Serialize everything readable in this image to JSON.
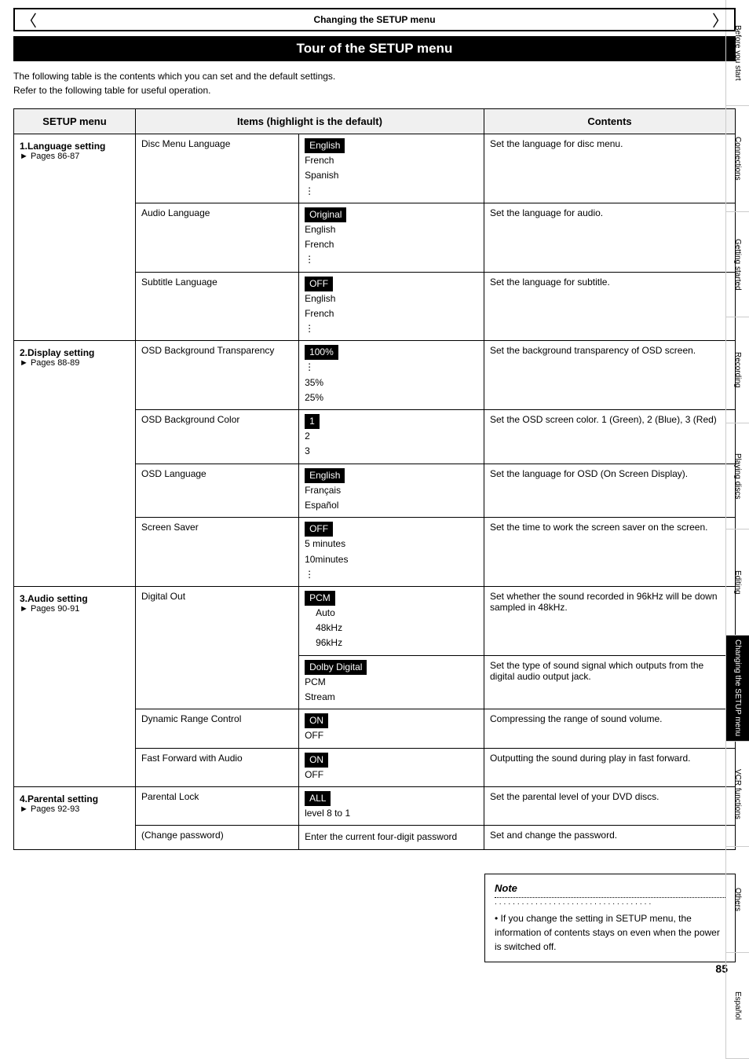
{
  "page": {
    "main_title": "Changing the SETUP menu",
    "section_title": "Tour of the SETUP menu",
    "intro": [
      "The following table is the contents which you can set and the default settings.",
      "Refer to the following table for useful operation."
    ],
    "table": {
      "headers": [
        "SETUP menu",
        "Items (highlight is the default)",
        "",
        "Contents"
      ],
      "sections": [
        {
          "menu": "1.Language setting",
          "pages": "Pages 86-87",
          "rows": [
            {
              "item": "Disc Menu Language",
              "values": [
                {
                  "text": "English",
                  "highlighted": true
                },
                {
                  "text": "French",
                  "highlighted": false
                },
                {
                  "text": "Spanish",
                  "highlighted": false
                },
                {
                  "text": "⋮",
                  "highlighted": false
                }
              ],
              "contents": "Set the language for disc menu."
            },
            {
              "item": "Audio Language",
              "values": [
                {
                  "text": "Original",
                  "highlighted": true
                },
                {
                  "text": "English",
                  "highlighted": false
                },
                {
                  "text": "French",
                  "highlighted": false
                },
                {
                  "text": "⋮",
                  "highlighted": false
                }
              ],
              "contents": "Set the language for audio."
            },
            {
              "item": "Subtitle Language",
              "values": [
                {
                  "text": "OFF",
                  "highlighted": true
                },
                {
                  "text": "English",
                  "highlighted": false
                },
                {
                  "text": "French",
                  "highlighted": false
                },
                {
                  "text": "⋮",
                  "highlighted": false
                }
              ],
              "contents": "Set the language for subtitle."
            }
          ]
        },
        {
          "menu": "2.Display setting",
          "pages": "Pages 88-89",
          "rows": [
            {
              "item": "OSD Background Transparency",
              "values": [
                {
                  "text": "100%",
                  "highlighted": true
                },
                {
                  "text": "⋮",
                  "highlighted": false
                },
                {
                  "text": "35%",
                  "highlighted": false
                },
                {
                  "text": "25%",
                  "highlighted": false
                }
              ],
              "contents": "Set the background transparency of OSD screen."
            },
            {
              "item": "OSD Background Color",
              "values": [
                {
                  "text": "1",
                  "highlighted": true
                },
                {
                  "text": "2",
                  "highlighted": false
                },
                {
                  "text": "3",
                  "highlighted": false
                }
              ],
              "contents": "Set the OSD screen color. 1 (Green), 2 (Blue), 3 (Red)"
            },
            {
              "item": "OSD Language",
              "values": [
                {
                  "text": "English",
                  "highlighted": true
                },
                {
                  "text": "Français",
                  "highlighted": false
                },
                {
                  "text": "Español",
                  "highlighted": false
                }
              ],
              "contents": "Set the language for OSD (On Screen Display)."
            },
            {
              "item": "Screen Saver",
              "values": [
                {
                  "text": "OFF",
                  "highlighted": true
                },
                {
                  "text": "5 minutes",
                  "highlighted": false
                },
                {
                  "text": "10minutes",
                  "highlighted": false
                },
                {
                  "text": "⋮",
                  "highlighted": false
                }
              ],
              "contents": "Set the time to work the screen saver on the screen."
            }
          ]
        },
        {
          "menu": "3.Audio setting",
          "pages": "Pages 90-91",
          "rows": [
            {
              "item": "Digital Out",
              "values_special": "digital_out",
              "contents": "Set whether the sound recorded in 96kHz will be down sampled in 48kHz."
            },
            {
              "item": "",
              "values_special": "digital_out_2",
              "contents": "Set the type of sound signal which outputs from the digital audio output jack."
            },
            {
              "item": "Dynamic Range Control",
              "values": [
                {
                  "text": "ON",
                  "highlighted": true
                },
                {
                  "text": "OFF",
                  "highlighted": false
                }
              ],
              "contents": "Compressing the range of sound volume."
            },
            {
              "item": "Fast Forward with Audio",
              "values": [
                {
                  "text": "ON",
                  "highlighted": true
                },
                {
                  "text": "OFF",
                  "highlighted": false
                }
              ],
              "contents": "Outputting the sound during play in fast forward."
            }
          ]
        },
        {
          "menu": "4.Parental setting",
          "pages": "Pages 92-93",
          "rows": [
            {
              "item": "Parental Lock",
              "values": [
                {
                  "text": "ALL",
                  "highlighted": true
                },
                {
                  "text": "level 8 to 1",
                  "highlighted": false
                }
              ],
              "contents": "Set the parental level of your DVD discs."
            },
            {
              "item": "(Change password)",
              "values": [
                {
                  "text": "Enter the current four-digit password",
                  "highlighted": false
                }
              ],
              "contents": "Set and change the password."
            }
          ]
        }
      ]
    },
    "note": {
      "title": "Note",
      "dots": "................................",
      "bullet": "• If you change the setting in SETUP menu, the information of contents stays on even when the power is switched off."
    },
    "page_number": "85",
    "sidebar": {
      "items": [
        {
          "label": "Before you start",
          "active": false
        },
        {
          "label": "Connections",
          "active": false
        },
        {
          "label": "Getting started",
          "active": false
        },
        {
          "label": "Recording",
          "active": false
        },
        {
          "label": "Playing discs",
          "active": false
        },
        {
          "label": "Editing",
          "active": false
        },
        {
          "label": "Changing the SETUP menu",
          "active": true
        },
        {
          "label": "VCR functions",
          "active": false
        },
        {
          "label": "Others",
          "active": false
        },
        {
          "label": "Español",
          "active": false
        }
      ]
    }
  }
}
